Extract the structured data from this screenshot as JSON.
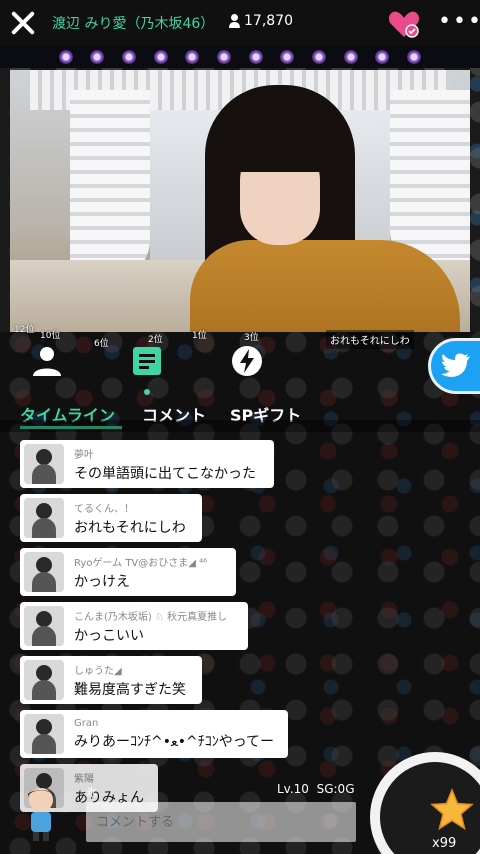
{
  "header": {
    "title": "渡辺 みり愛（乃木坂46）",
    "viewer_count": "17,870"
  },
  "ranks": [
    "12位",
    "10位",
    "2位",
    "1位",
    "6位",
    "3位"
  ],
  "overlay_comment": "おれもそれにしわ",
  "tabs": [
    {
      "label": "タイムライン"
    },
    {
      "label": "コメント"
    },
    {
      "label": "SPギフト"
    }
  ],
  "comments": [
    {
      "name": "夢叶",
      "message": "その単語頭に出てこなかった"
    },
    {
      "name": "てるくん、！",
      "message": "おれもそれにしわ"
    },
    {
      "name": "Ryoゲーム TV@おひさま◢ ⁴⁶",
      "message": "かっけえ"
    },
    {
      "name": "こんま(乃木坂垢) ♘ 秋元真夏推し",
      "message": "かっこいい"
    },
    {
      "name": "しゅうた◢",
      "message": "難易度高すぎた笑"
    },
    {
      "name": "Gran",
      "message": "みりあーｺﾝﾁ^•ﻌ•^ﾁｺﾝやってー"
    },
    {
      "name": "紫陽",
      "message": "ありみょん"
    }
  ],
  "footer": {
    "user_name": "氷",
    "level": "Lv.10",
    "sg": "SG:0G",
    "comment_placeholder": "コメントする",
    "star_count": "x99"
  },
  "colors": {
    "accent": "#3fd6a4",
    "heart": "#e94b8a",
    "twitter": "#1da1f2",
    "star": "#f6b73c"
  }
}
